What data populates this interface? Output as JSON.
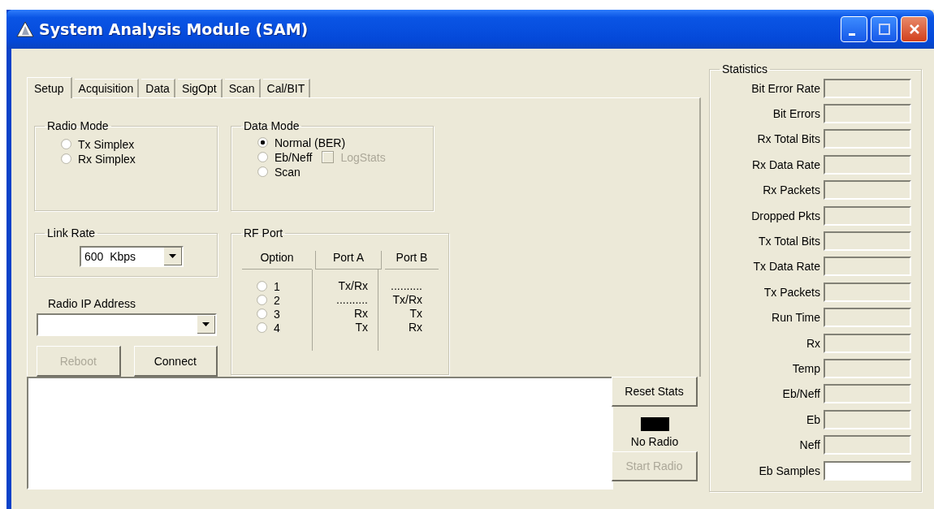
{
  "window": {
    "title": "System Analysis Module (SAM)"
  },
  "tabs": [
    {
      "label": "Setup",
      "selected": true
    },
    {
      "label": "Acquisition",
      "selected": false
    },
    {
      "label": "Data",
      "selected": false
    },
    {
      "label": "SigOpt",
      "selected": false
    },
    {
      "label": "Scan",
      "selected": false
    },
    {
      "label": "Cal/BIT",
      "selected": false
    }
  ],
  "radio_mode": {
    "title": "Radio Mode",
    "options": [
      {
        "label": "Tx Simplex",
        "selected": false
      },
      {
        "label": "Rx Simplex",
        "selected": false
      }
    ]
  },
  "data_mode": {
    "title": "Data Mode",
    "options": [
      {
        "label": "Normal (BER)",
        "selected": true
      },
      {
        "label": "Eb/Neff",
        "selected": false
      },
      {
        "label": "Scan",
        "selected": false
      }
    ],
    "log_stats": {
      "label": "LogStats",
      "checked": false,
      "disabled": true
    }
  },
  "link_rate": {
    "title": "Link Rate",
    "value": "600  Kbps"
  },
  "radio_ip": {
    "label": "Radio IP Address"
  },
  "buttons": [
    {
      "label": "Reboot",
      "disabled": true
    },
    {
      "label": "Connect",
      "disabled": false
    }
  ],
  "rf_port": {
    "title": "RF Port",
    "columns": [
      "Option",
      "Port A",
      "Port B"
    ],
    "rows": [
      {
        "option": "1",
        "port_a": "Tx/Rx",
        "port_b": "..........",
        "selected": false
      },
      {
        "option": "2",
        "port_a": "..........",
        "port_b": "Tx/Rx",
        "selected": false
      },
      {
        "option": "3",
        "port_a": "Rx",
        "port_b": "Tx",
        "selected": false
      },
      {
        "option": "4",
        "port_a": "Tx",
        "port_b": "Rx",
        "selected": false
      }
    ]
  },
  "reset_stats": {
    "label": "Reset Stats",
    "disabled": false
  },
  "status": {
    "label": "No Radio",
    "color": "#000000"
  },
  "start_radio": {
    "label": "Start Radio",
    "disabled": true
  },
  "statistics": {
    "title": "Statistics",
    "rows": [
      {
        "label": "Bit Error Rate",
        "kind": "readonly"
      },
      {
        "label": "Bit Errors",
        "kind": "readonly"
      },
      {
        "label": "Rx Total Bits",
        "kind": "readonly"
      },
      {
        "label": "Rx Data Rate",
        "kind": "readonly"
      },
      {
        "label": "Rx Packets",
        "kind": "readonly"
      },
      {
        "label": "Dropped Pkts",
        "kind": "readonly"
      },
      {
        "label": "Tx Total Bits",
        "kind": "readonly"
      },
      {
        "label": "Tx Data Rate",
        "kind": "readonly"
      },
      {
        "label": "Tx Packets",
        "kind": "readonly"
      },
      {
        "label": "Run Time",
        "kind": "readonly"
      },
      {
        "label": "Rx",
        "kind": "readonly"
      },
      {
        "label": "Temp",
        "kind": "readonly"
      },
      {
        "label": "Eb/Neff",
        "kind": "readonly"
      },
      {
        "label": "Eb",
        "kind": "readonly"
      },
      {
        "label": "Neff",
        "kind": "readonly"
      },
      {
        "label": "Eb Samples",
        "kind": "editable"
      }
    ]
  }
}
